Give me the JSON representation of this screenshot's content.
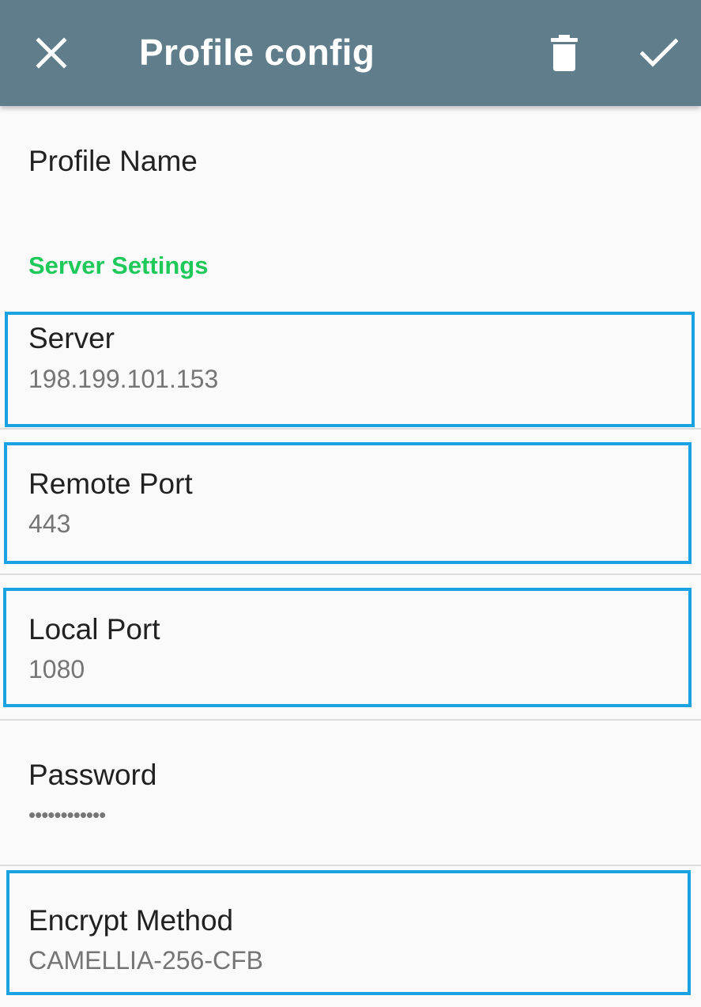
{
  "appbar": {
    "title": "Profile config",
    "close_icon": "close-icon",
    "delete_icon": "trash-icon",
    "save_icon": "check-icon",
    "background_color": "#607d8b"
  },
  "profile_name": {
    "label": "Profile Name"
  },
  "server_settings": {
    "header": "Server Settings",
    "header_color": "#1ec95a",
    "items": {
      "server": {
        "label": "Server",
        "value": "198.199.101.153"
      },
      "remote_port": {
        "label": "Remote Port",
        "value": "443"
      },
      "local_port": {
        "label": "Local Port",
        "value": "1080"
      },
      "password": {
        "label": "Password",
        "value": "••••••••••••"
      },
      "encrypt_method": {
        "label": "Encrypt Method",
        "value": "CAMELLIA-256-CFB"
      }
    }
  },
  "highlight_color": "#1aa3e0"
}
